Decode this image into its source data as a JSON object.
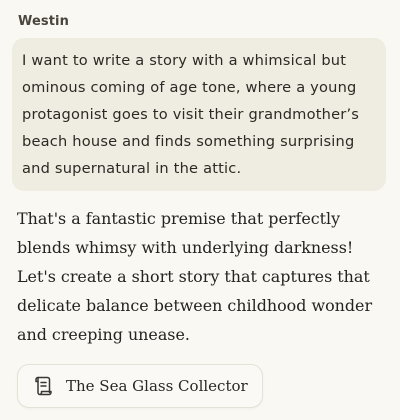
{
  "message": {
    "sender": "Westin",
    "user_text": "I want to write a story with a whimsical but ominous coming of age tone, where a young protagonist goes to visit their grandmother’s beach house and finds something surprising and supernatural in the attic.",
    "assistant_text": "That's a fantastic premise that perfectly blends whimsy with underlying darkness! Let's create a short story that captures that delicate balance between childhood wonder and creeping unease."
  },
  "artifact": {
    "icon": "document-icon",
    "title": "The Sea Glass Collector"
  },
  "colors": {
    "background": "#f9f8f3",
    "user_bubble": "#efede2",
    "card_border": "#e4e1d6",
    "text": "#2c2a25"
  }
}
